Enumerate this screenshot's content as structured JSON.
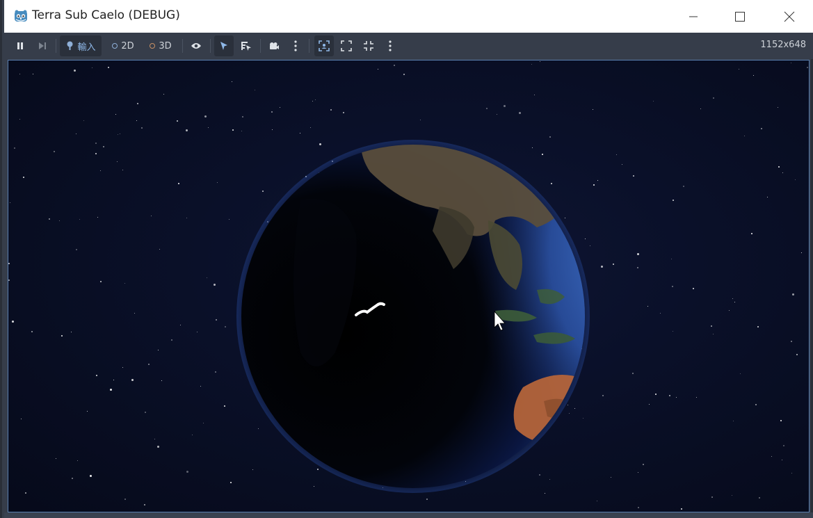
{
  "window": {
    "title": "Terra Sub Caelo (DEBUG)"
  },
  "toolbar": {
    "input_label": "輸入",
    "mode_2d_label": "2D",
    "mode_3d_label": "3D",
    "resolution": "1152x648"
  },
  "icons": {
    "app": "godot-icon",
    "pause": "pause-icon",
    "step": "step-forward-icon",
    "input": "joystick-icon",
    "visibility": "eye-icon",
    "select": "pointer-icon",
    "list_select": "list-select-icon",
    "camera": "camera-icon",
    "more": "kebab-menu-icon",
    "focus": "focus-frame-icon",
    "expand": "expand-icon",
    "fullscreen": "fullscreen-icon"
  },
  "colors": {
    "toolbar_bg": "#363d4a",
    "accent": "#5a7fb0",
    "space": "#0a1029"
  }
}
